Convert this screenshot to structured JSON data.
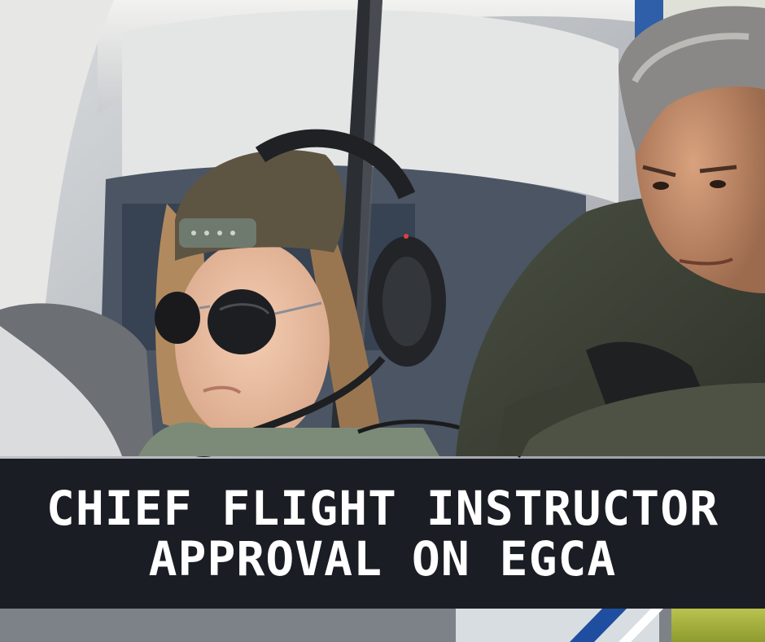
{
  "banner": {
    "line1": "CHIEF FLIGHT INSTRUCTOR",
    "line2": "APPROVAL ON EGCA"
  },
  "colors": {
    "banner_background": "#1b1d24",
    "banner_text": "#ffffff"
  }
}
